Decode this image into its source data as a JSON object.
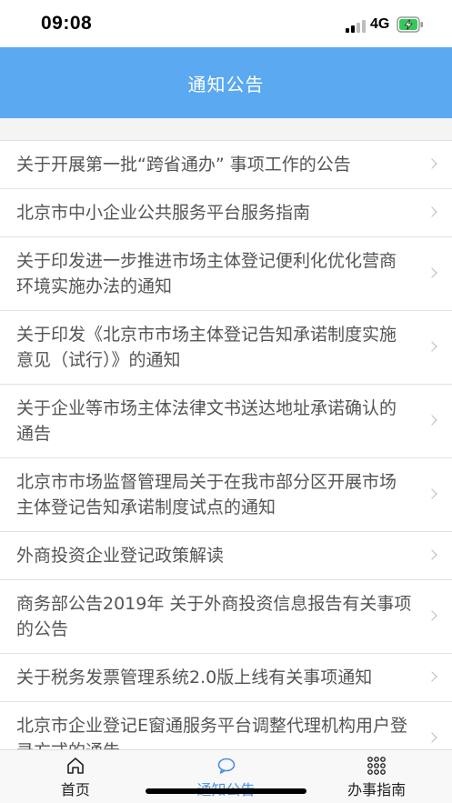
{
  "status_bar": {
    "time": "09:08",
    "network": "4G",
    "signal_bars": 2,
    "battery_icon": "battery-charging-icon"
  },
  "header": {
    "title": "通知公告",
    "background": "#5aa9f1"
  },
  "notices": [
    {
      "title": "关于开展第一批“跨省通办” 事项工作的公告"
    },
    {
      "title": "北京市中小企业公共服务平台服务指南"
    },
    {
      "title": "关于印发进一步推进市场主体登记便利化优化营商环境实施办法的通知"
    },
    {
      "title": "关于印发《北京市市场主体登记告知承诺制度实施意见（试行）》的通知"
    },
    {
      "title": "关于企业等市场主体法律文书送达地址承诺确认的通告"
    },
    {
      "title": "北京市市场监督管理局关于在我市部分区开展市场主体登记告知承诺制度试点的通知"
    },
    {
      "title": "外商投资企业登记政策解读"
    },
    {
      "title": "商务部公告2019年 关于外商投资信息报告有关事项的公告"
    },
    {
      "title": "关于税务发票管理系统2.0版上线有关事项通知"
    },
    {
      "title": "北京市企业登记E窗通服务平台调整代理机构用户登录方式的通告"
    }
  ],
  "tabbar": {
    "tabs": [
      {
        "label": "首页",
        "icon": "home-icon"
      },
      {
        "label": "通知公告",
        "icon": "chat-bubble-icon",
        "active": true
      },
      {
        "label": "办事指南",
        "icon": "grid-dots-icon"
      }
    ],
    "active_color": "#4a90e2"
  }
}
